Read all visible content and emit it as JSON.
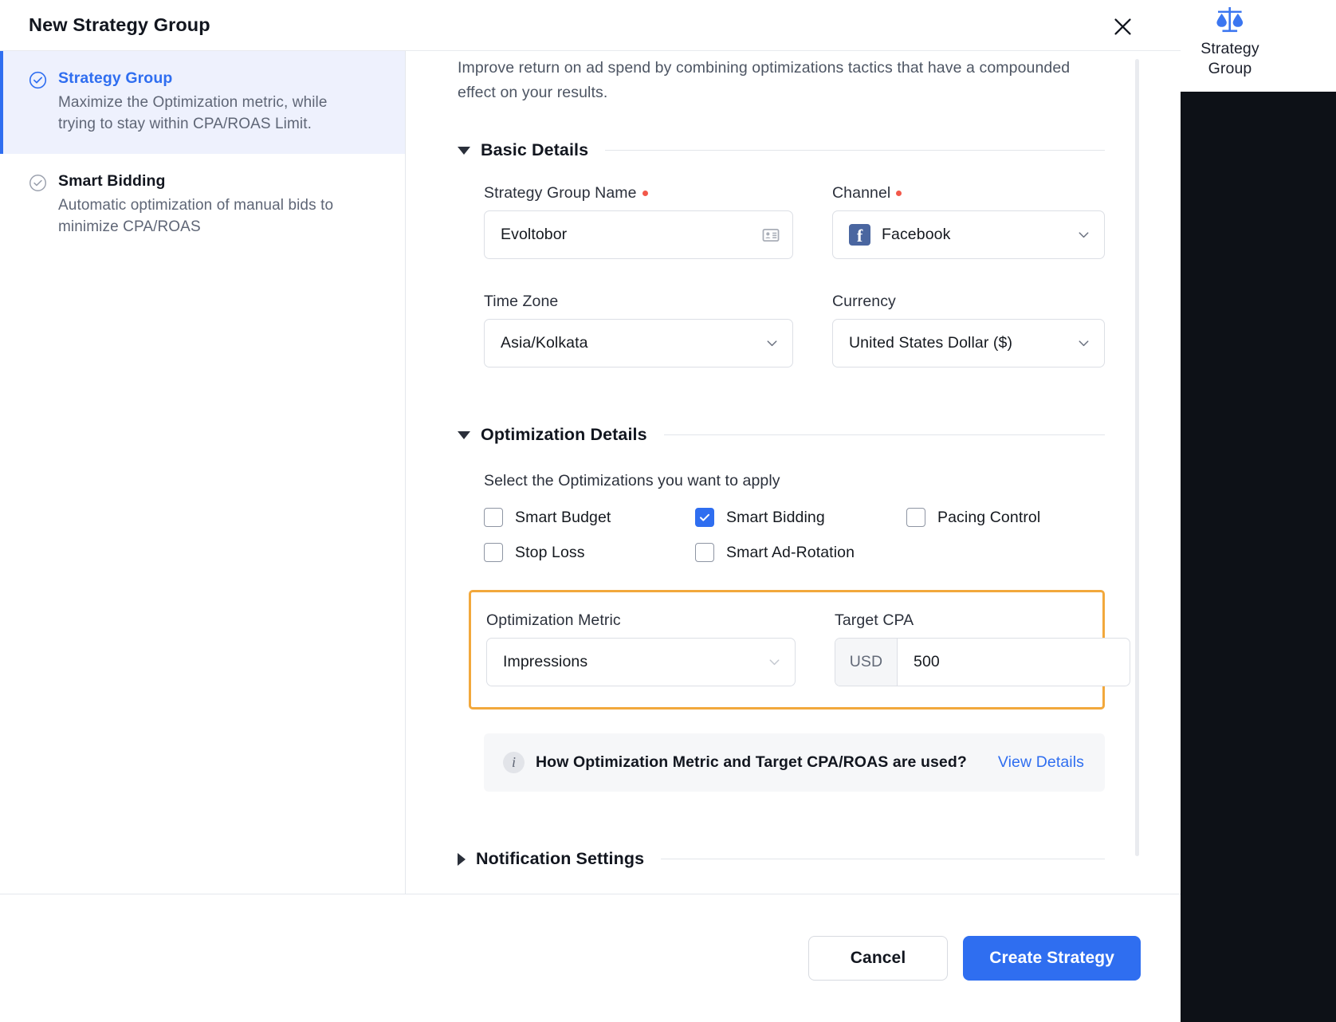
{
  "dialog": {
    "title": "New Strategy Group",
    "close_icon": "close-icon"
  },
  "rail": {
    "icon": "scales-icon",
    "label_line1": "Strategy",
    "label_line2": "Group"
  },
  "sidebar": {
    "items": [
      {
        "title": "Strategy Group",
        "desc": "Maximize the Optimization metric, while trying to stay within CPA/ROAS Limit.",
        "icon": "check-circle-icon",
        "active": true
      },
      {
        "title": "Smart Bidding",
        "desc": "Automatic optimization of manual bids to minimize CPA/ROAS",
        "icon": "check-circle-icon",
        "active": false
      }
    ]
  },
  "main": {
    "intro": "Improve return on ad spend by combining optimizations tactics that have a compounded effect on your results.",
    "basic_details": {
      "heading": "Basic Details",
      "strategy_group_name_label": "Strategy Group Name",
      "strategy_group_name_value": "Evoltobor",
      "strategy_group_name_icon": "contact-card-icon",
      "channel_label": "Channel",
      "channel_value": "Facebook",
      "channel_icon": "facebook-icon",
      "time_zone_label": "Time Zone",
      "time_zone_value": "Asia/Kolkata",
      "currency_label": "Currency",
      "currency_value": "United States Dollar ($)"
    },
    "optimization_details": {
      "heading": "Optimization Details",
      "subtitle": "Select the Optimizations you want to apply",
      "checkboxes": [
        {
          "label": "Smart Budget",
          "checked": false
        },
        {
          "label": "Smart Bidding",
          "checked": true
        },
        {
          "label": "Pacing Control",
          "checked": false
        },
        {
          "label": "Stop Loss",
          "checked": false
        },
        {
          "label": "Smart Ad-Rotation",
          "checked": false
        }
      ],
      "optimization_metric_label": "Optimization Metric",
      "optimization_metric_value": "Impressions",
      "target_cpa_label": "Target CPA",
      "target_cpa_prefix": "USD",
      "target_cpa_value": "500",
      "highlight_color": "#f2a83c"
    },
    "info_banner": {
      "icon": "info-icon",
      "text": "How Optimization Metric and Target CPA/ROAS are used?",
      "link": "View Details"
    },
    "notification_settings": {
      "heading": "Notification Settings"
    }
  },
  "footer": {
    "cancel_label": "Cancel",
    "create_label": "Create Strategy",
    "primary_color": "#2f6ef0"
  }
}
